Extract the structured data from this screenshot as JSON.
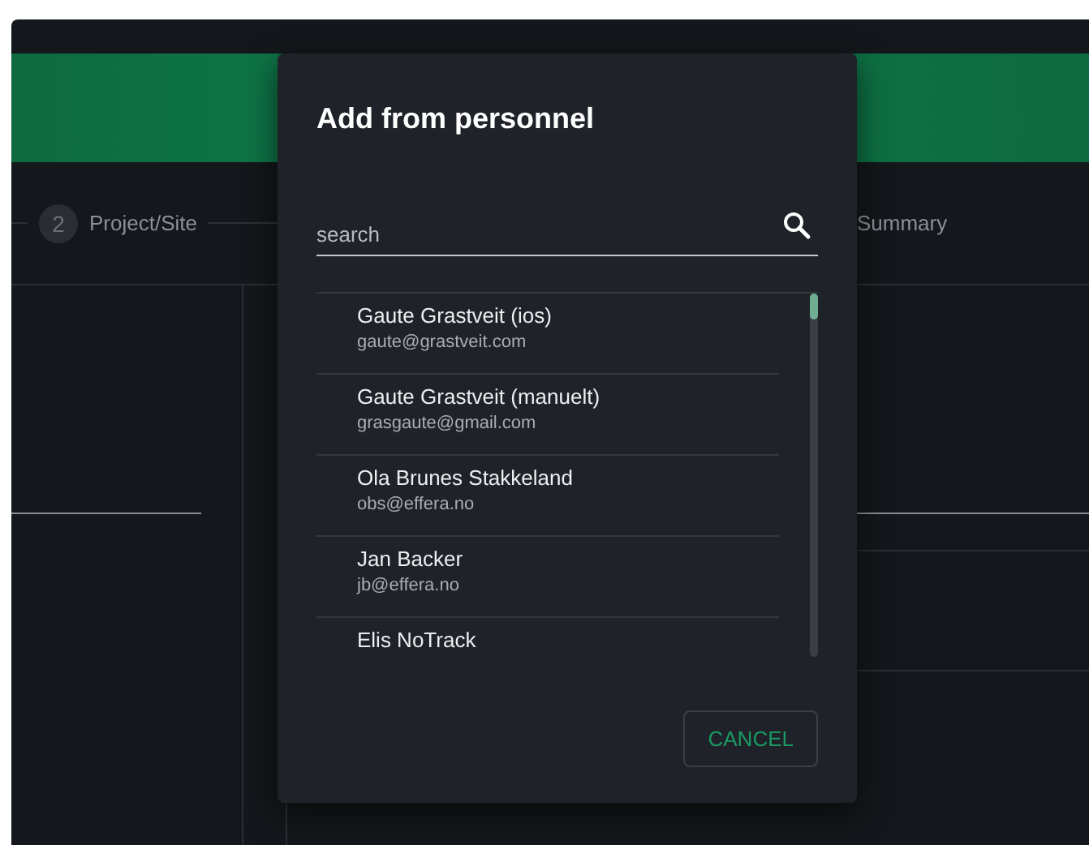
{
  "stepper": {
    "steps": [
      {
        "number": "2",
        "label": "Project/Site"
      },
      {
        "label": "Summary"
      }
    ]
  },
  "dialog": {
    "title": "Add from personnel",
    "search": {
      "placeholder": "search"
    },
    "people": [
      {
        "name": "Gaute Grastveit (ios)",
        "email": "gaute@grastveit.com"
      },
      {
        "name": "Gaute Grastveit (manuelt)",
        "email": "grasgaute@gmail.com"
      },
      {
        "name": "Ola Brunes Stakkeland",
        "email": "obs@effera.no"
      },
      {
        "name": "Jan Backer",
        "email": "jb@effera.no"
      },
      {
        "name": "Elis NoTrack"
      }
    ],
    "buttons": [
      "CANCEL"
    ]
  }
}
